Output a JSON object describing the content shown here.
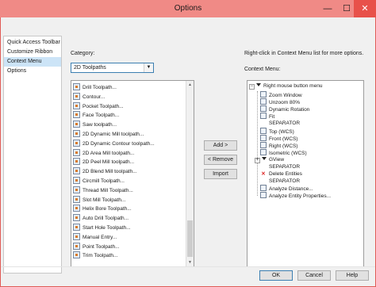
{
  "window": {
    "title": "Options",
    "minimize_glyph": "—",
    "maximize_glyph": "☐",
    "close_glyph": "✕"
  },
  "nav": {
    "items": [
      {
        "label": "Quick Access Toolbar"
      },
      {
        "label": "Customize Ribbon"
      },
      {
        "label": "Context Menu"
      },
      {
        "label": "Options"
      }
    ],
    "selected": "Context Menu"
  },
  "category": {
    "label": "Category:",
    "selected_value": "2D Toolpaths"
  },
  "commands": {
    "items": [
      "Drill Toolpath...",
      "Contour...",
      "Pocket Toolpath...",
      "Face Toolpath...",
      "Saw toolpath...",
      "2D Dynamic Mill toolpath...",
      "2D Dynamic Contour toolpath...",
      "2D Area Mill toolpath...",
      "2D Peel Mill toolpath...",
      "2D Blend Mill toolpath...",
      "Circmill Toolpath...",
      "Thread Mill Toolpath...",
      "Slot Mill Toolpath...",
      "Helix Bore Toolpath...",
      "Auto Drill Toolpath...",
      "Start Hole Toolpath...",
      "Manual Entry...",
      "Point Toolpath...",
      "Trim Toolpath..."
    ]
  },
  "buttons": {
    "add": "Add >",
    "remove": "< Remove",
    "import": "Import",
    "ok": "OK",
    "cancel": "Cancel",
    "help": "Help"
  },
  "context_menu": {
    "info": "Right-click in Context Menu list for more options.",
    "label": "Context Menu:",
    "root": "Right mouse button menu",
    "items": [
      {
        "label": "Zoom Window",
        "icon": "zoom-window-icon"
      },
      {
        "label": "Unzoom 80%",
        "icon": "unzoom-icon"
      },
      {
        "label": "Dynamic Rotation",
        "icon": "dynamic-rotation-icon"
      },
      {
        "label": "Fit",
        "icon": "fit-icon"
      },
      {
        "label": "SEPARATOR",
        "icon": ""
      },
      {
        "label": "Top (WCS)",
        "icon": "top-view-icon"
      },
      {
        "label": "Front (WCS)",
        "icon": "front-view-icon"
      },
      {
        "label": "Right (WCS)",
        "icon": "right-view-icon"
      },
      {
        "label": "Isometric (WCS)",
        "icon": "isometric-view-icon"
      },
      {
        "label": "GView",
        "icon": "submenu"
      },
      {
        "label": "SEPARATOR",
        "icon": ""
      },
      {
        "label": "Delete Entities",
        "icon": "delete-icon"
      },
      {
        "label": "SEPARATOR",
        "icon": ""
      },
      {
        "label": "Analyze Distance...",
        "icon": "analyze-distance-icon"
      },
      {
        "label": "Analyze Entity Properties...",
        "icon": "analyze-entity-icon"
      }
    ]
  }
}
